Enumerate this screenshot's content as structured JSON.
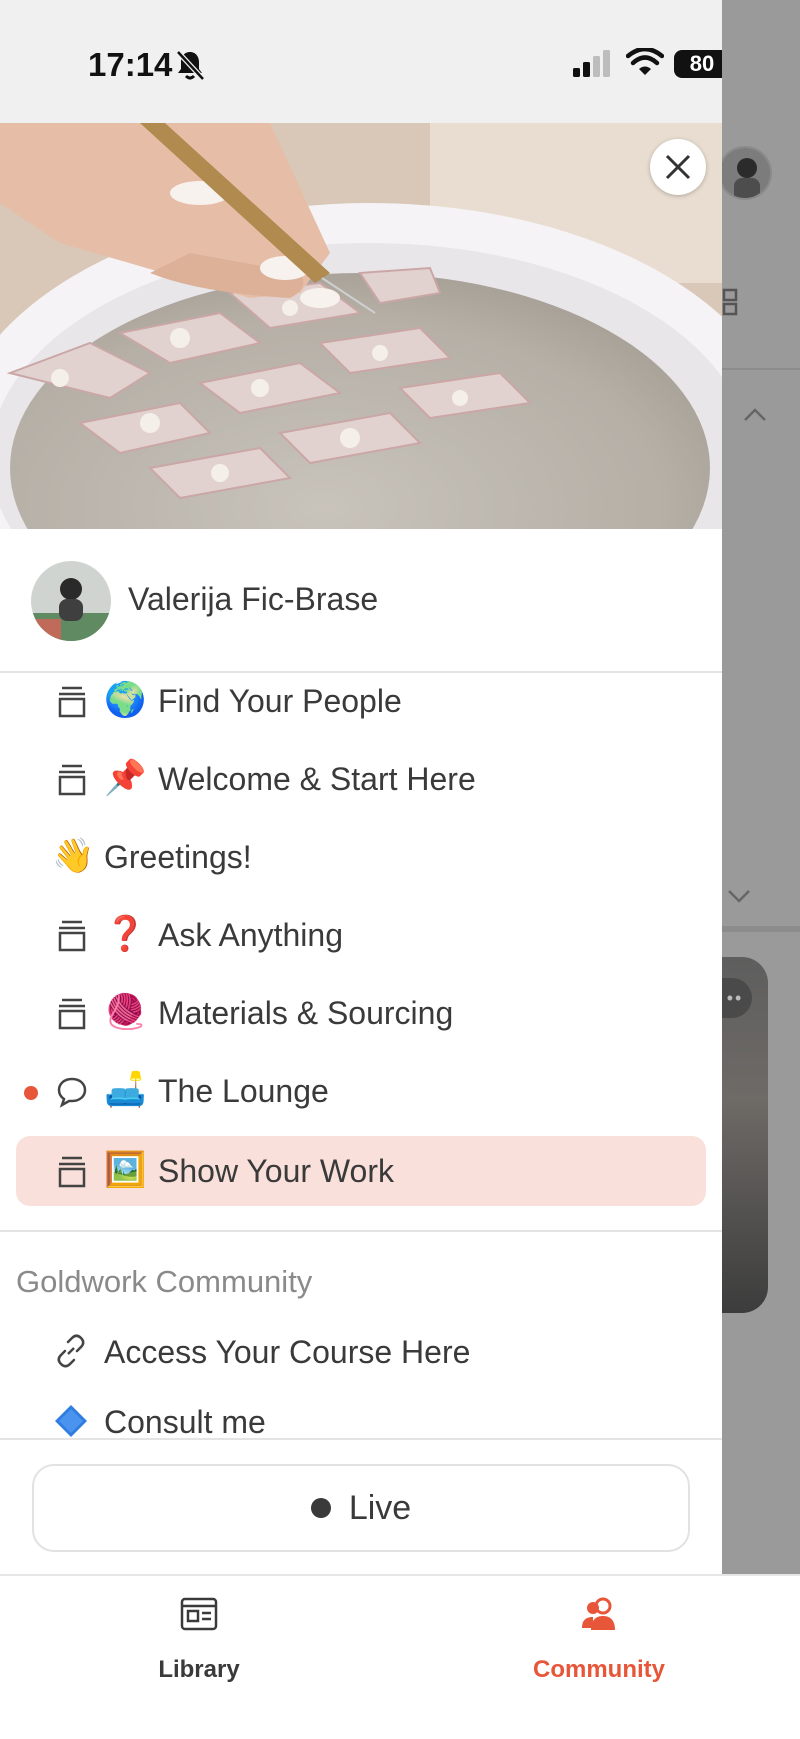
{
  "status_bar": {
    "time": "17:14",
    "battery": "80"
  },
  "profile": {
    "name": "Valerija Fic-Brase"
  },
  "channels": [
    {
      "label": "Find Your People",
      "emoji": "🌍",
      "type": "forum",
      "unread": false,
      "active": false
    },
    {
      "label": "Welcome & Start Here",
      "emoji": "📌",
      "type": "forum",
      "unread": false,
      "active": false
    },
    {
      "label": "Greetings!",
      "emoji": "👋",
      "type": "none",
      "unread": false,
      "active": false
    },
    {
      "label": "Ask Anything",
      "emoji": "❓",
      "type": "forum",
      "unread": false,
      "active": false
    },
    {
      "label": "Materials & Sourcing",
      "emoji": "🧶",
      "type": "forum",
      "unread": false,
      "active": false
    },
    {
      "label": "The Lounge",
      "emoji": "🛋️",
      "type": "chat",
      "unread": true,
      "active": false
    },
    {
      "label": "Show Your Work",
      "emoji": "🖼️",
      "type": "forum",
      "unread": false,
      "active": true
    }
  ],
  "section": {
    "title": "Goldwork Community",
    "items": [
      {
        "label": "Access Your Course Here",
        "icon": "link-icon"
      },
      {
        "label": "Consult me",
        "icon": "blue-diamond-icon"
      }
    ]
  },
  "live": {
    "label": "Live"
  },
  "tabbar": {
    "library": "Library",
    "community": "Community"
  },
  "colors": {
    "accent": "#e8563a",
    "active_bg": "#f9e0da",
    "text": "#3a3a3a",
    "muted": "#8a8a8a"
  }
}
